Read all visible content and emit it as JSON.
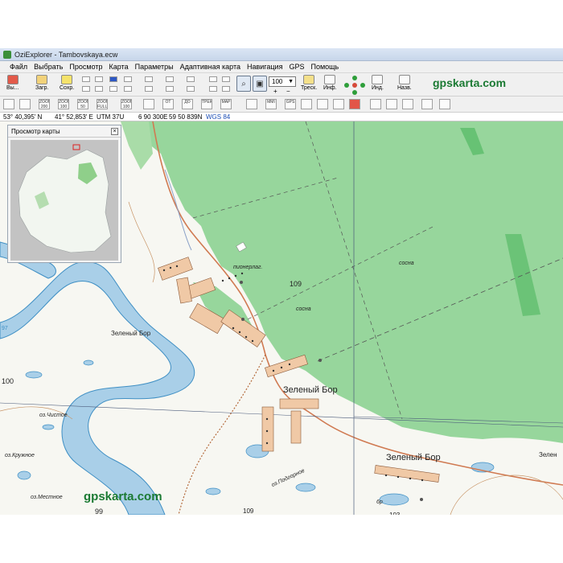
{
  "window": {
    "title": "OziExplorer - Tambovskaya.ecw"
  },
  "menu": [
    "Файл",
    "Выбрать",
    "Просмотр",
    "Карта",
    "Параметры",
    "Адаптивная карта",
    "Навигация",
    "GPS",
    "Помощь"
  ],
  "toolbar": {
    "exit_label": "Вы...",
    "load_label": "Загр.",
    "save_label": "Сохр.",
    "zoom_value": "100",
    "track_label": "Треск.",
    "info_label": "Инф.",
    "index_label": "Инд.",
    "name_label": "Назв.",
    "brand": "gpskarta.com",
    "mini_labels": [
      "+ТРЕК",
      "ZOOM 200",
      "ZOOM 100",
      "ZOOM 50",
      "ZOOM FULL",
      "ZOOM 100",
      "ОТ",
      "ДО",
      "ТРЕК",
      "MAP",
      "MMI",
      "GPS"
    ]
  },
  "status": {
    "lat": "53° 40,395' N",
    "lon": "41° 52,853' E",
    "utm_zone": "UTM  37U",
    "easting": "6 90 300E",
    "northing": "59 50 839N",
    "datum": "WGS 84"
  },
  "overview": {
    "title": "Просмотр карты"
  },
  "map": {
    "labels": {
      "pionerlag": "пионерлаг.",
      "h109": "109",
      "sosna1": "сосна",
      "sosna2": "сосна",
      "zb_left": "Зеленый Бор",
      "zb_center": "Зеленый Бор",
      "zb_right": "Зеленый Бор",
      "zb_edge": "Зелен",
      "h100": "100",
      "lake_chistoe": "оз.Чистое",
      "lake_kruzhnoe": "оз.Кружное",
      "lake_podgornoe": "оз.Подгорное",
      "lake_mestnoe": "оз.Местное",
      "h109b": "109",
      "h99": "99",
      "h97": "97",
      "h103": "103",
      "h6r": "6р"
    },
    "watermark": "gpskarta.com"
  },
  "colors": {
    "forest": "#97d69c",
    "river": "#a9cfe8",
    "river_edge": "#3f8fc4",
    "settlement": "#f0c9a6",
    "brand": "#1b7a33"
  }
}
